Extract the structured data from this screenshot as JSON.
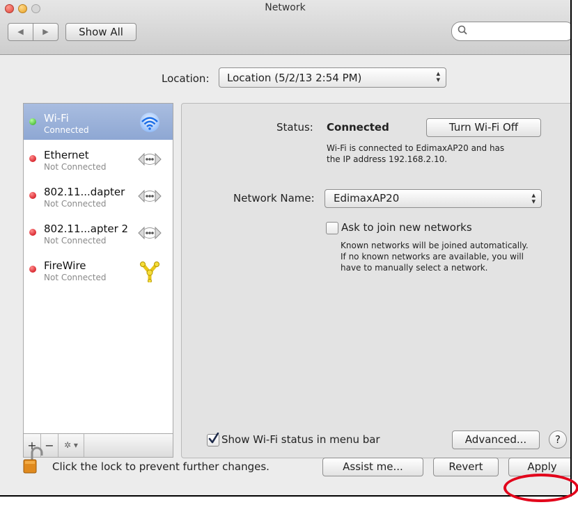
{
  "window": {
    "title": "Network"
  },
  "toolbar": {
    "back_glyph": "◀",
    "forward_glyph": "▶",
    "show_all_label": "Show All",
    "search_icon": "magnifying-glass",
    "search_placeholder": ""
  },
  "location": {
    "label": "Location:",
    "value": "Location (5/2/13 2:54 PM)"
  },
  "services": [
    {
      "name": "Wi-Fi",
      "status": "Connected",
      "state": "green",
      "icon": "wifi-icon",
      "selected": true
    },
    {
      "name": "Ethernet",
      "status": "Not Connected",
      "state": "red",
      "icon": "ethernet-icon",
      "selected": false
    },
    {
      "name": "802.11...dapter",
      "status": "Not Connected",
      "state": "red",
      "icon": "ethernet-icon",
      "selected": false
    },
    {
      "name": "802.11...apter 2",
      "status": "Not Connected",
      "state": "red",
      "icon": "ethernet-icon",
      "selected": false
    },
    {
      "name": "FireWire",
      "status": "Not Connected",
      "state": "red",
      "icon": "firewire-icon",
      "selected": false
    }
  ],
  "sidebar_controls": {
    "add": "+",
    "remove": "−",
    "action": "✲ ▾"
  },
  "detail": {
    "status_label": "Status:",
    "status_value": "Connected",
    "turn_off_label": "Turn Wi-Fi Off",
    "status_desc_line1": "Wi-Fi is connected to EdimaxAP20 and has",
    "status_desc_line2": "the IP address 192.168.2.10.",
    "network_name_label": "Network Name:",
    "network_name_value": "EdimaxAP20",
    "ask_join_label": "Ask to join new networks",
    "ask_join_checked": false,
    "ask_join_desc_line1": "Known networks will be joined automatically.",
    "ask_join_desc_line2": "If no known networks are available, you will",
    "ask_join_desc_line3": "have to manually select a network.",
    "show_status_label": "Show Wi-Fi status in menu bar",
    "show_status_checked": true,
    "advanced_label": "Advanced...",
    "help_label": "?"
  },
  "footer": {
    "lock_text": "Click the lock to prevent further changes.",
    "assist_label": "Assist me...",
    "revert_label": "Revert",
    "apply_label": "Apply"
  },
  "colors": {
    "selection": "#8ea7d3",
    "annotation": "#e2001a",
    "connected": "#2aa71a",
    "not_connected": "#c9000b"
  }
}
